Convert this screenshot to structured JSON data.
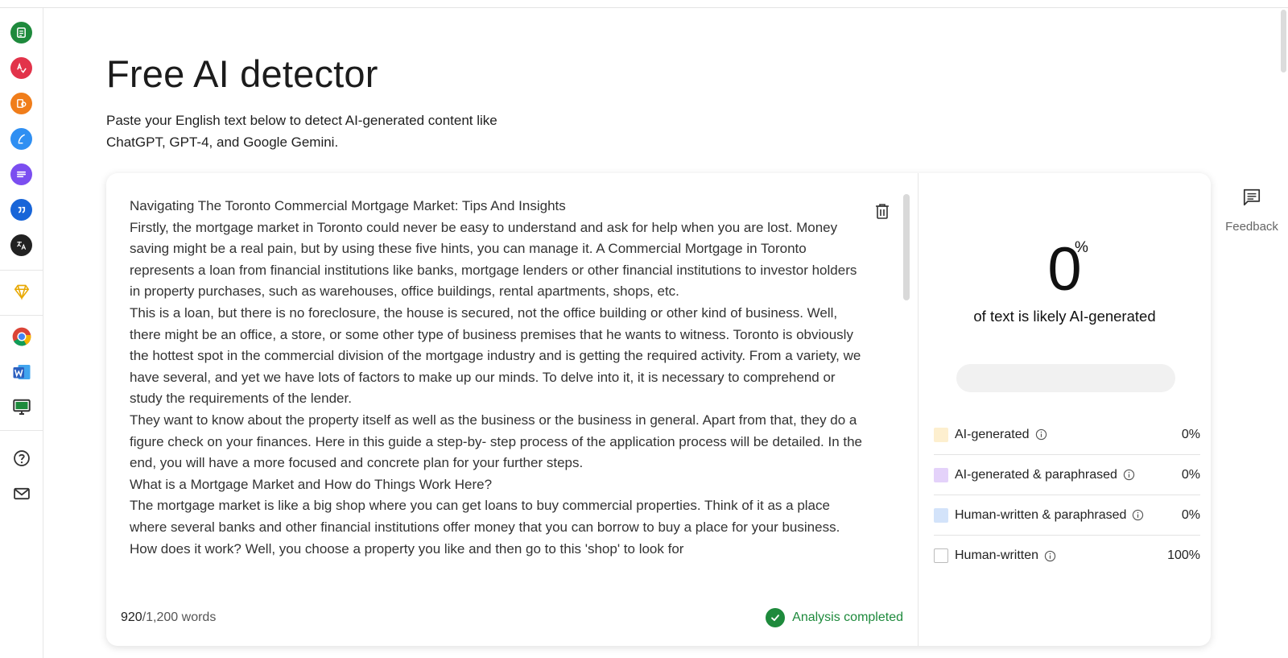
{
  "page": {
    "title": "Free AI detector",
    "subtitle": "Paste your English text below to detect AI-generated content like ChatGPT, GPT-4, and Google Gemini."
  },
  "sidebar": {
    "items": [
      {
        "icon": "document-check-icon",
        "color": "#1e8a3c"
      },
      {
        "icon": "spell-check-icon",
        "color": "#e2334a"
      },
      {
        "icon": "plagiarism-icon",
        "color": "#f07d1a"
      },
      {
        "icon": "paraphrase-pen-icon",
        "color": "#2f8ff2"
      },
      {
        "icon": "summarizer-lines-icon",
        "color": "#7b4ef0"
      },
      {
        "icon": "citation-quote-icon",
        "color": "#1865d8"
      },
      {
        "icon": "translate-icon",
        "color": "#222222"
      },
      {
        "icon": "premium-diamond-icon",
        "color": "#e8a800"
      },
      {
        "icon": "chrome-icon",
        "color": "#db4437"
      },
      {
        "icon": "word-icon",
        "color": "#2b5fbf"
      },
      {
        "icon": "desktop-app-icon",
        "color": "#1e8a3c"
      },
      {
        "icon": "help-icon",
        "color": "#333333"
      },
      {
        "icon": "mail-icon",
        "color": "#333333"
      }
    ]
  },
  "editor": {
    "paragraphs": [
      "Navigating The Toronto Commercial Mortgage Market: Tips And Insights",
      "Firstly, the mortgage market in Toronto could never be easy to understand and ask for help when you are lost. Money saving might be a real pain, but by using these five hints, you can manage it. A Commercial Mortgage in Toronto represents a loan from financial institutions like banks, mortgage lenders or other financial institutions to investor holders in property purchases, such as warehouses, office buildings, rental apartments, shops, etc.",
      "This is a loan, but there is no foreclosure, the house is secured, not the office building or other kind of business. Well, there might be an office, a store, or some other type of business premises that he wants to witness. Toronto is obviously the hottest spot in the commercial division of the mortgage industry and is getting the required activity. From a variety, we have several, and yet we have lots of factors to make up our minds. To delve into it, it is necessary to comprehend or study the requirements of the lender.",
      "They want to know about the property itself as well as the business or the business in general. Apart from that, they do a figure check on your finances. Here in this guide a step-by- step process of the application process will be detailed. In the end, you will have a more focused and concrete plan for your further steps.",
      "What is a Mortgage Market and How do Things Work Here?",
      "The mortgage market is like a big shop where you can get loans to buy commercial properties. Think of it as a place where several banks and other financial institutions offer money that you can borrow to buy a place for your business. How does it work? Well, you choose a property you like and then go to this 'shop' to look for"
    ],
    "word_count": "920",
    "word_limit": "/1,200 words",
    "status": "Analysis completed"
  },
  "results": {
    "percent": "0",
    "percent_symbol": "%",
    "caption": "of text is likely AI-generated",
    "ai_fraction": 0,
    "legend": [
      {
        "label": "AI-generated",
        "value": "0%",
        "color": "#fdefcf"
      },
      {
        "label": "AI-generated & paraphrased",
        "value": "0%",
        "color": "#e4d2fa"
      },
      {
        "label": "Human-written & paraphrased",
        "value": "0%",
        "color": "#d3e3fa"
      },
      {
        "label": "Human-written",
        "value": "100%",
        "color": "#ffffff"
      }
    ]
  },
  "feedback": {
    "label": "Feedback"
  }
}
